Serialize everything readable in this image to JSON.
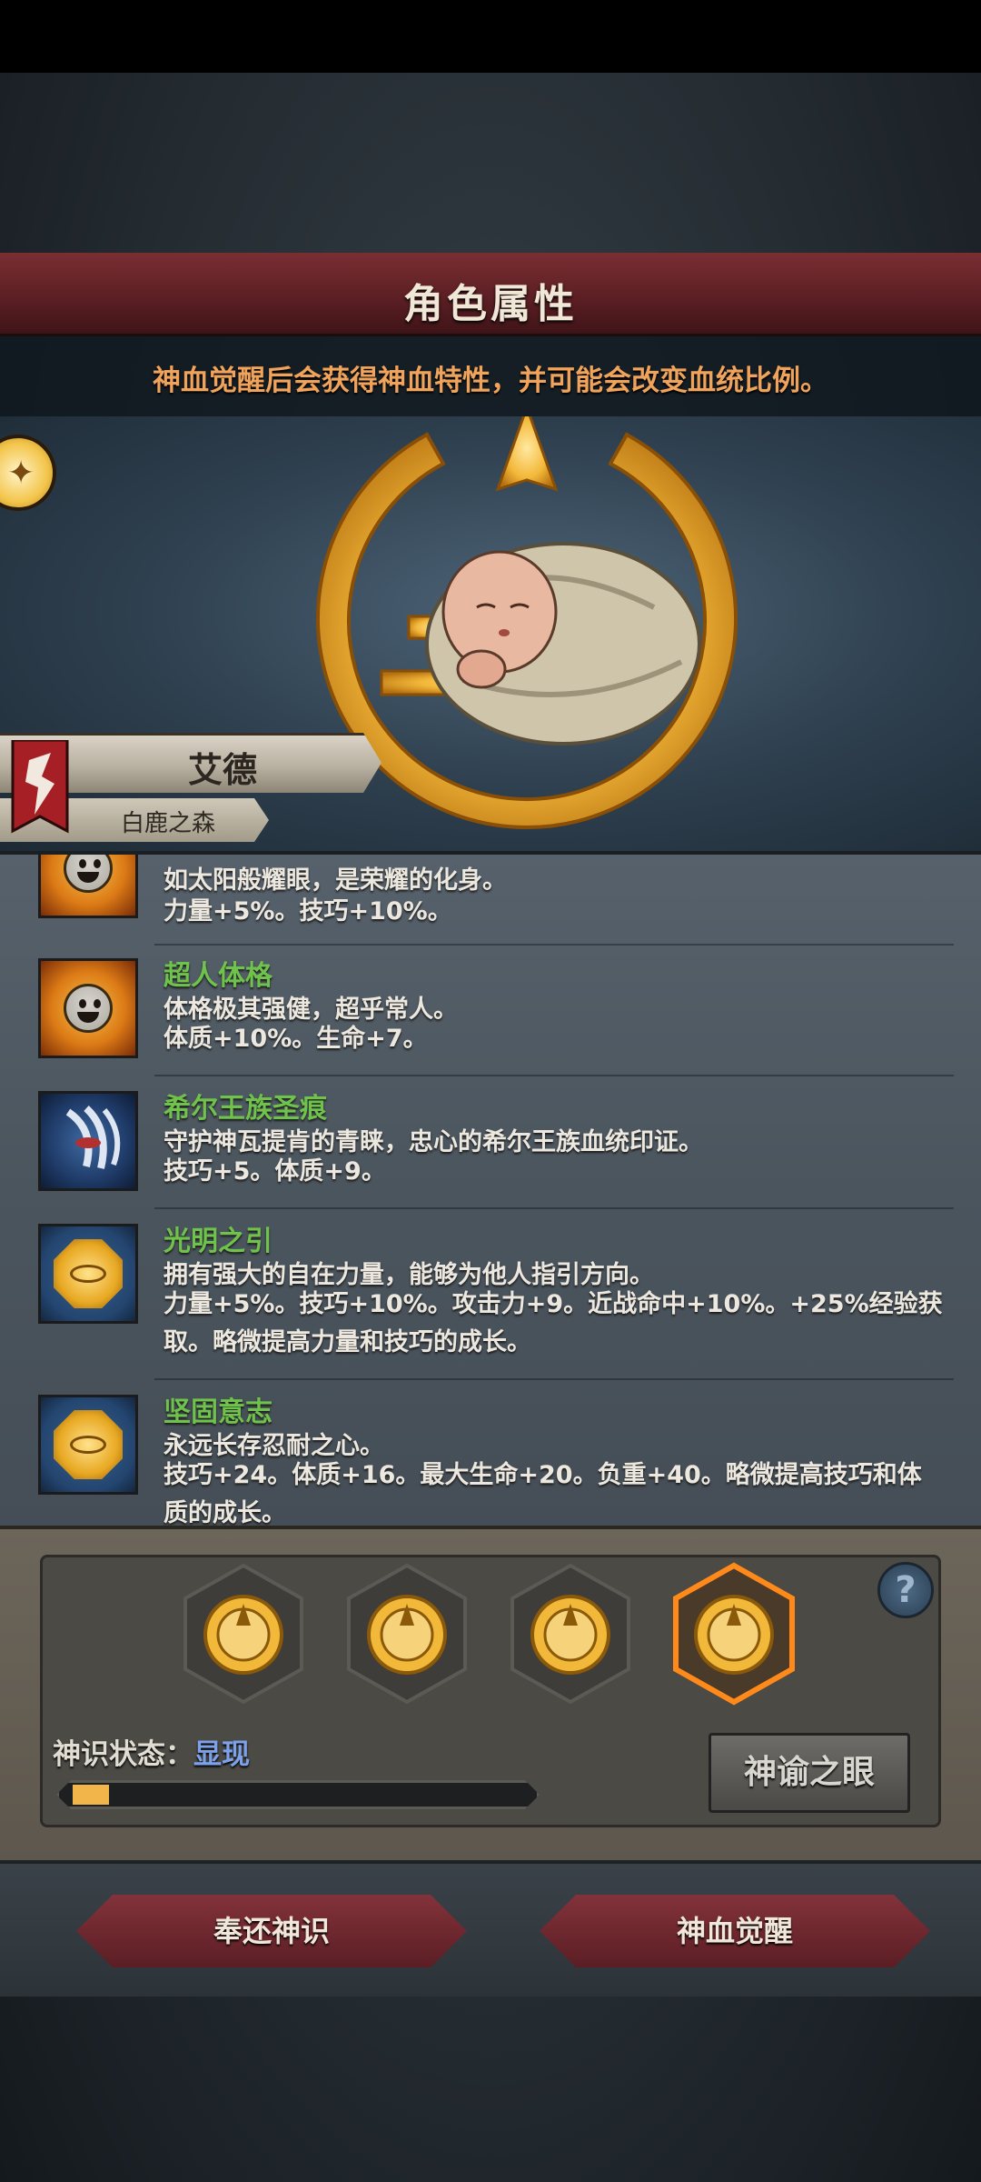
{
  "header": {
    "title": "角色属性",
    "subtitle": "神血觉醒后会获得神血特性，并可能会改变血统比例。"
  },
  "character": {
    "name": "艾德",
    "homeland": "白鹿之森"
  },
  "traits": [
    {
      "name": "",
      "desc": "如太阳般耀眼，是荣耀的化身。",
      "stats": "力量+5%。技巧+10%。",
      "icon": "sun-face-icon"
    },
    {
      "name": "超人体格",
      "desc": "体格极其强健，超乎常人。",
      "stats": "体质+10%。生命+7。",
      "icon": "sun-face-icon"
    },
    {
      "name": "希尔王族圣痕",
      "desc": "守护神瓦提肯的青睐，忠心的希尔王族血统印证。",
      "stats": "技巧+5。体质+9。",
      "icon": "claw-mark-icon"
    },
    {
      "name": "光明之引",
      "desc": "拥有强大的自在力量，能够为他人指引方向。",
      "stats": "力量+5%。技巧+10%。攻击力+9。近战命中+10%。+25%经验获取。略微提高力量和技巧的成长。",
      "icon": "golden-eye-icon"
    },
    {
      "name": "坚固意志",
      "desc": "永远长存忍耐之心。",
      "stats": "技巧+24。体质+16。最大生命+20。负重+40。略微提高技巧和体质的成长。",
      "icon": "golden-eye-icon"
    }
  ],
  "divine": {
    "status_label": "神识状态：",
    "status_value": "显现",
    "progress": 0.08,
    "oracle_button": "神谕之眼",
    "help": "?"
  },
  "actions": {
    "return_label": "奉还神识",
    "awaken_label": "神血觉醒"
  },
  "colors": {
    "trait_name": "#6fc24b",
    "status_value": "#7ea2ea",
    "progress_fill": "#f1b54a",
    "title_banner": "#6b262b",
    "hex_selected_border": "#ff8a1a"
  }
}
